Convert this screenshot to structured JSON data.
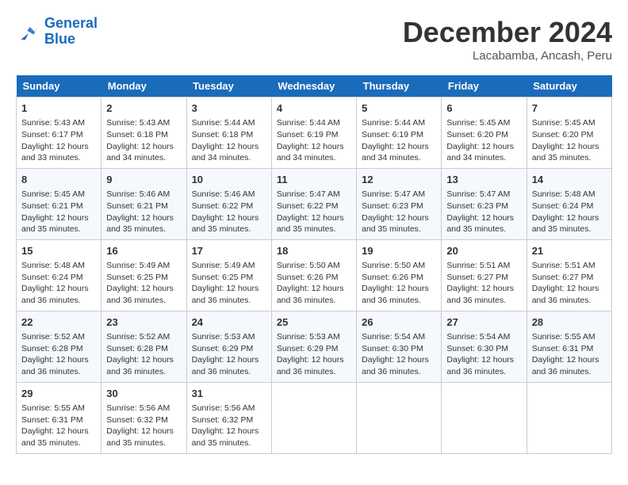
{
  "logo": {
    "line1": "General",
    "line2": "Blue"
  },
  "title": "December 2024",
  "location": "Lacabamba, Ancash, Peru",
  "days_of_week": [
    "Sunday",
    "Monday",
    "Tuesday",
    "Wednesday",
    "Thursday",
    "Friday",
    "Saturday"
  ],
  "weeks": [
    [
      {
        "day": 1,
        "info": "Sunrise: 5:43 AM\nSunset: 6:17 PM\nDaylight: 12 hours\nand 33 minutes."
      },
      {
        "day": 2,
        "info": "Sunrise: 5:43 AM\nSunset: 6:18 PM\nDaylight: 12 hours\nand 34 minutes."
      },
      {
        "day": 3,
        "info": "Sunrise: 5:44 AM\nSunset: 6:18 PM\nDaylight: 12 hours\nand 34 minutes."
      },
      {
        "day": 4,
        "info": "Sunrise: 5:44 AM\nSunset: 6:19 PM\nDaylight: 12 hours\nand 34 minutes."
      },
      {
        "day": 5,
        "info": "Sunrise: 5:44 AM\nSunset: 6:19 PM\nDaylight: 12 hours\nand 34 minutes."
      },
      {
        "day": 6,
        "info": "Sunrise: 5:45 AM\nSunset: 6:20 PM\nDaylight: 12 hours\nand 34 minutes."
      },
      {
        "day": 7,
        "info": "Sunrise: 5:45 AM\nSunset: 6:20 PM\nDaylight: 12 hours\nand 35 minutes."
      }
    ],
    [
      {
        "day": 8,
        "info": "Sunrise: 5:45 AM\nSunset: 6:21 PM\nDaylight: 12 hours\nand 35 minutes."
      },
      {
        "day": 9,
        "info": "Sunrise: 5:46 AM\nSunset: 6:21 PM\nDaylight: 12 hours\nand 35 minutes."
      },
      {
        "day": 10,
        "info": "Sunrise: 5:46 AM\nSunset: 6:22 PM\nDaylight: 12 hours\nand 35 minutes."
      },
      {
        "day": 11,
        "info": "Sunrise: 5:47 AM\nSunset: 6:22 PM\nDaylight: 12 hours\nand 35 minutes."
      },
      {
        "day": 12,
        "info": "Sunrise: 5:47 AM\nSunset: 6:23 PM\nDaylight: 12 hours\nand 35 minutes."
      },
      {
        "day": 13,
        "info": "Sunrise: 5:47 AM\nSunset: 6:23 PM\nDaylight: 12 hours\nand 35 minutes."
      },
      {
        "day": 14,
        "info": "Sunrise: 5:48 AM\nSunset: 6:24 PM\nDaylight: 12 hours\nand 35 minutes."
      }
    ],
    [
      {
        "day": 15,
        "info": "Sunrise: 5:48 AM\nSunset: 6:24 PM\nDaylight: 12 hours\nand 36 minutes."
      },
      {
        "day": 16,
        "info": "Sunrise: 5:49 AM\nSunset: 6:25 PM\nDaylight: 12 hours\nand 36 minutes."
      },
      {
        "day": 17,
        "info": "Sunrise: 5:49 AM\nSunset: 6:25 PM\nDaylight: 12 hours\nand 36 minutes."
      },
      {
        "day": 18,
        "info": "Sunrise: 5:50 AM\nSunset: 6:26 PM\nDaylight: 12 hours\nand 36 minutes."
      },
      {
        "day": 19,
        "info": "Sunrise: 5:50 AM\nSunset: 6:26 PM\nDaylight: 12 hours\nand 36 minutes."
      },
      {
        "day": 20,
        "info": "Sunrise: 5:51 AM\nSunset: 6:27 PM\nDaylight: 12 hours\nand 36 minutes."
      },
      {
        "day": 21,
        "info": "Sunrise: 5:51 AM\nSunset: 6:27 PM\nDaylight: 12 hours\nand 36 minutes."
      }
    ],
    [
      {
        "day": 22,
        "info": "Sunrise: 5:52 AM\nSunset: 6:28 PM\nDaylight: 12 hours\nand 36 minutes."
      },
      {
        "day": 23,
        "info": "Sunrise: 5:52 AM\nSunset: 6:28 PM\nDaylight: 12 hours\nand 36 minutes."
      },
      {
        "day": 24,
        "info": "Sunrise: 5:53 AM\nSunset: 6:29 PM\nDaylight: 12 hours\nand 36 minutes."
      },
      {
        "day": 25,
        "info": "Sunrise: 5:53 AM\nSunset: 6:29 PM\nDaylight: 12 hours\nand 36 minutes."
      },
      {
        "day": 26,
        "info": "Sunrise: 5:54 AM\nSunset: 6:30 PM\nDaylight: 12 hours\nand 36 minutes."
      },
      {
        "day": 27,
        "info": "Sunrise: 5:54 AM\nSunset: 6:30 PM\nDaylight: 12 hours\nand 36 minutes."
      },
      {
        "day": 28,
        "info": "Sunrise: 5:55 AM\nSunset: 6:31 PM\nDaylight: 12 hours\nand 36 minutes."
      }
    ],
    [
      {
        "day": 29,
        "info": "Sunrise: 5:55 AM\nSunset: 6:31 PM\nDaylight: 12 hours\nand 35 minutes."
      },
      {
        "day": 30,
        "info": "Sunrise: 5:56 AM\nSunset: 6:32 PM\nDaylight: 12 hours\nand 35 minutes."
      },
      {
        "day": 31,
        "info": "Sunrise: 5:56 AM\nSunset: 6:32 PM\nDaylight: 12 hours\nand 35 minutes."
      },
      null,
      null,
      null,
      null
    ]
  ]
}
